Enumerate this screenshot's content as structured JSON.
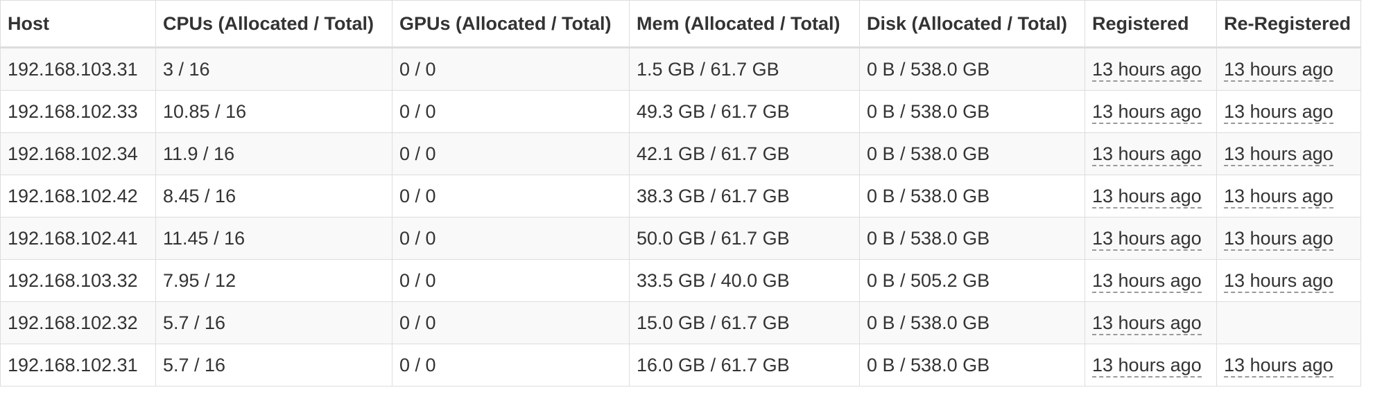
{
  "table": {
    "headers": [
      "Host",
      "CPUs (Allocated / Total)",
      "GPUs (Allocated / Total)",
      "Mem (Allocated / Total)",
      "Disk (Allocated / Total)",
      "Registered",
      "Re-Registered"
    ],
    "rows": [
      {
        "host": "192.168.103.31",
        "cpus": "3 / 16",
        "gpus": "0 / 0",
        "mem": "1.5 GB / 61.7 GB",
        "disk": "0 B / 538.0 GB",
        "registered": "13 hours ago",
        "reregistered": "13 hours ago"
      },
      {
        "host": "192.168.102.33",
        "cpus": "10.85 / 16",
        "gpus": "0 / 0",
        "mem": "49.3 GB / 61.7 GB",
        "disk": "0 B / 538.0 GB",
        "registered": "13 hours ago",
        "reregistered": "13 hours ago"
      },
      {
        "host": "192.168.102.34",
        "cpus": "11.9 / 16",
        "gpus": "0 / 0",
        "mem": "42.1 GB / 61.7 GB",
        "disk": "0 B / 538.0 GB",
        "registered": "13 hours ago",
        "reregistered": "13 hours ago"
      },
      {
        "host": "192.168.102.42",
        "cpus": "8.45 / 16",
        "gpus": "0 / 0",
        "mem": "38.3 GB / 61.7 GB",
        "disk": "0 B / 538.0 GB",
        "registered": "13 hours ago",
        "reregistered": "13 hours ago"
      },
      {
        "host": "192.168.102.41",
        "cpus": "11.45 / 16",
        "gpus": "0 / 0",
        "mem": "50.0 GB / 61.7 GB",
        "disk": "0 B / 538.0 GB",
        "registered": "13 hours ago",
        "reregistered": "13 hours ago"
      },
      {
        "host": "192.168.103.32",
        "cpus": "7.95 / 12",
        "gpus": "0 / 0",
        "mem": "33.5 GB / 40.0 GB",
        "disk": "0 B / 505.2 GB",
        "registered": "13 hours ago",
        "reregistered": "13 hours ago"
      },
      {
        "host": "192.168.102.32",
        "cpus": "5.7 / 16",
        "gpus": "0 / 0",
        "mem": "15.0 GB / 61.7 GB",
        "disk": "0 B / 538.0 GB",
        "registered": "13 hours ago",
        "reregistered": ""
      },
      {
        "host": "192.168.102.31",
        "cpus": "5.7 / 16",
        "gpus": "0 / 0",
        "mem": "16.0 GB / 61.7 GB",
        "disk": "0 B / 538.0 GB",
        "registered": "13 hours ago",
        "reregistered": "13 hours ago"
      }
    ]
  }
}
